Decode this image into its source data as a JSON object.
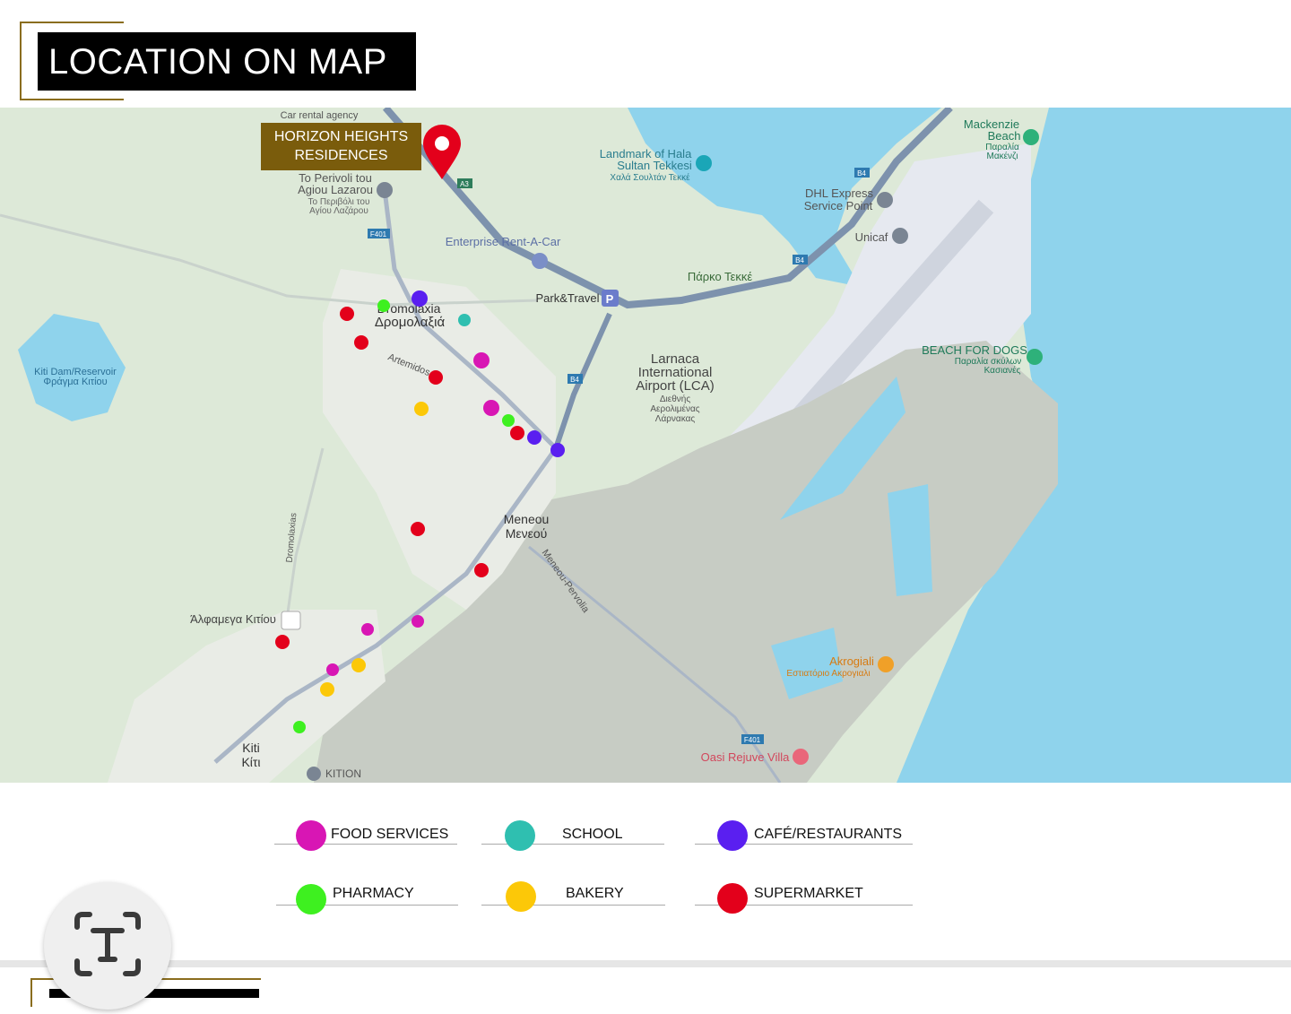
{
  "header": {
    "title": "LOCATION ON MAP"
  },
  "property": {
    "name_line1": "HORIZON HEIGHTS",
    "name_line2": "RESIDENCES"
  },
  "map_labels": {
    "car_rental": "Car rental agency",
    "perivoli_en1": "To Perivoli tou",
    "perivoli_en2": "Agiou Lazarou",
    "perivoli_gr1": "Το Περιβόλι του",
    "perivoli_gr2": "Αγίου Λαζάρου",
    "enterprise": "Enterprise Rent-A-Car",
    "landmark1": "Landmark of Hala",
    "landmark2": "Sultan Tekkesi",
    "landmark_gr": "Χαλά Σουλτάν Τεκκέ",
    "mackenzie1": "Mackenzie",
    "mackenzie2": "Beach",
    "mackenzie_gr1": "Παραλία",
    "mackenzie_gr2": "Μακένζι",
    "dhl1": "DHL Express",
    "dhl2": "Service Point",
    "unicaf": "Unicaf",
    "parko": "Πάρκο Τεκκέ",
    "park_travel": "Park&Travel",
    "dromolaxia": "Dromolaxia",
    "dromolaxia_gr": "Δρομολαξιά",
    "kiti_dam1": "Kiti Dam/Reservoir",
    "kiti_dam2": "Φράγμα Κιτίου",
    "artemidos": "Artemidos",
    "airport1": "Larnaca",
    "airport2": "International",
    "airport3": "Airport (LCA)",
    "airport_gr1": "Διεθνής",
    "airport_gr2": "Αερολιμένας",
    "airport_gr3": "Λάρνακας",
    "beach_dogs": "BEACH FOR DOGS",
    "beach_dogs_gr1": "Παραλία σκύλων",
    "beach_dogs_gr2": "Κασιανές",
    "meneou": "Meneou",
    "meneou_gr": "Μενεού",
    "meneou_pervolia": "Meneou-Pervolia",
    "dromolaxias_road": "Dromolaxias",
    "alfamega": "Άλφαμεγα Κιτίου",
    "akrogiali": "Akrogiali",
    "akrogiali_gr": "Εστιατόριο Ακρογιαλι",
    "oasi": "Oasi Rejuve Villa",
    "kiti": "Kiti",
    "kiti_gr": "Κίτι",
    "kition": "KITION",
    "road_a3": "A3",
    "road_f401a": "F401",
    "road_b4a": "B4",
    "road_b4b": "B4",
    "road_b4c": "B4",
    "road_f401b": "F401",
    "parking_sign": "P"
  },
  "legend": [
    {
      "label": "FOOD SERVICES",
      "color": "#d816b4"
    },
    {
      "label": "SCHOOL",
      "color": "#2fbfb0"
    },
    {
      "label": "CAFÉ/RESTAURANTS",
      "color": "#5a1ff0"
    },
    {
      "label": "PHARMACY",
      "color": "#3ef020"
    },
    {
      "label": "BAKERY",
      "color": "#fcc808"
    },
    {
      "label": "SUPERMARKET",
      "color": "#e3001b"
    }
  ],
  "colors": {
    "water": "#8fd3ec",
    "land_green": "#dde9d8",
    "airport": "#e6e9f0",
    "grey_land": "#c7ccc4",
    "road": "#7d92ad",
    "pin": "#e3001b",
    "gold": "#7a5c0c"
  },
  "icons": {
    "scan_text": "text-scan-icon",
    "pin": "map-pin-icon"
  }
}
